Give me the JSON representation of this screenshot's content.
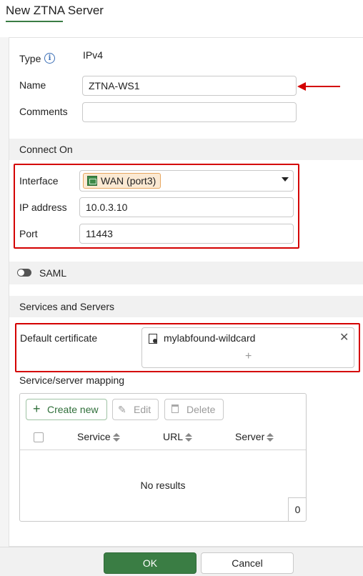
{
  "header": {
    "title": "New ZTNA Server"
  },
  "form": {
    "type_label": "Type",
    "type_value": "IPv4",
    "name_label": "Name",
    "name_value": "ZTNA-WS1",
    "comments_label": "Comments",
    "comments_value": ""
  },
  "connect_on": {
    "section_title": "Connect On",
    "interface_label": "Interface",
    "interface_value": "WAN (port3)",
    "ip_label": "IP address",
    "ip_value": "10.0.3.10",
    "port_label": "Port",
    "port_value": "11443"
  },
  "saml": {
    "label": "SAML",
    "enabled": false
  },
  "services": {
    "section_title": "Services and Servers",
    "default_cert_label": "Default certificate",
    "default_cert_value": "mylabfound-wildcard",
    "mapping_label": "Service/server mapping",
    "toolbar": {
      "create": "Create new",
      "edit": "Edit",
      "delete": "Delete"
    },
    "columns": [
      "Service",
      "URL",
      "Server"
    ],
    "empty_text": "No results",
    "count": "0"
  },
  "footer": {
    "ok": "OK",
    "cancel": "Cancel"
  },
  "colors": {
    "accent": "#3a7d44",
    "highlight_box": "#d40000",
    "annotation_arrow": "#d40000"
  },
  "icons": [
    "info-icon",
    "interface-port-icon",
    "dropdown-caret-icon",
    "certificate-icon",
    "clear-icon",
    "add-icon",
    "plus-icon",
    "edit-pencil-icon",
    "trash-icon",
    "sort-icon",
    "toggle-icon"
  ]
}
